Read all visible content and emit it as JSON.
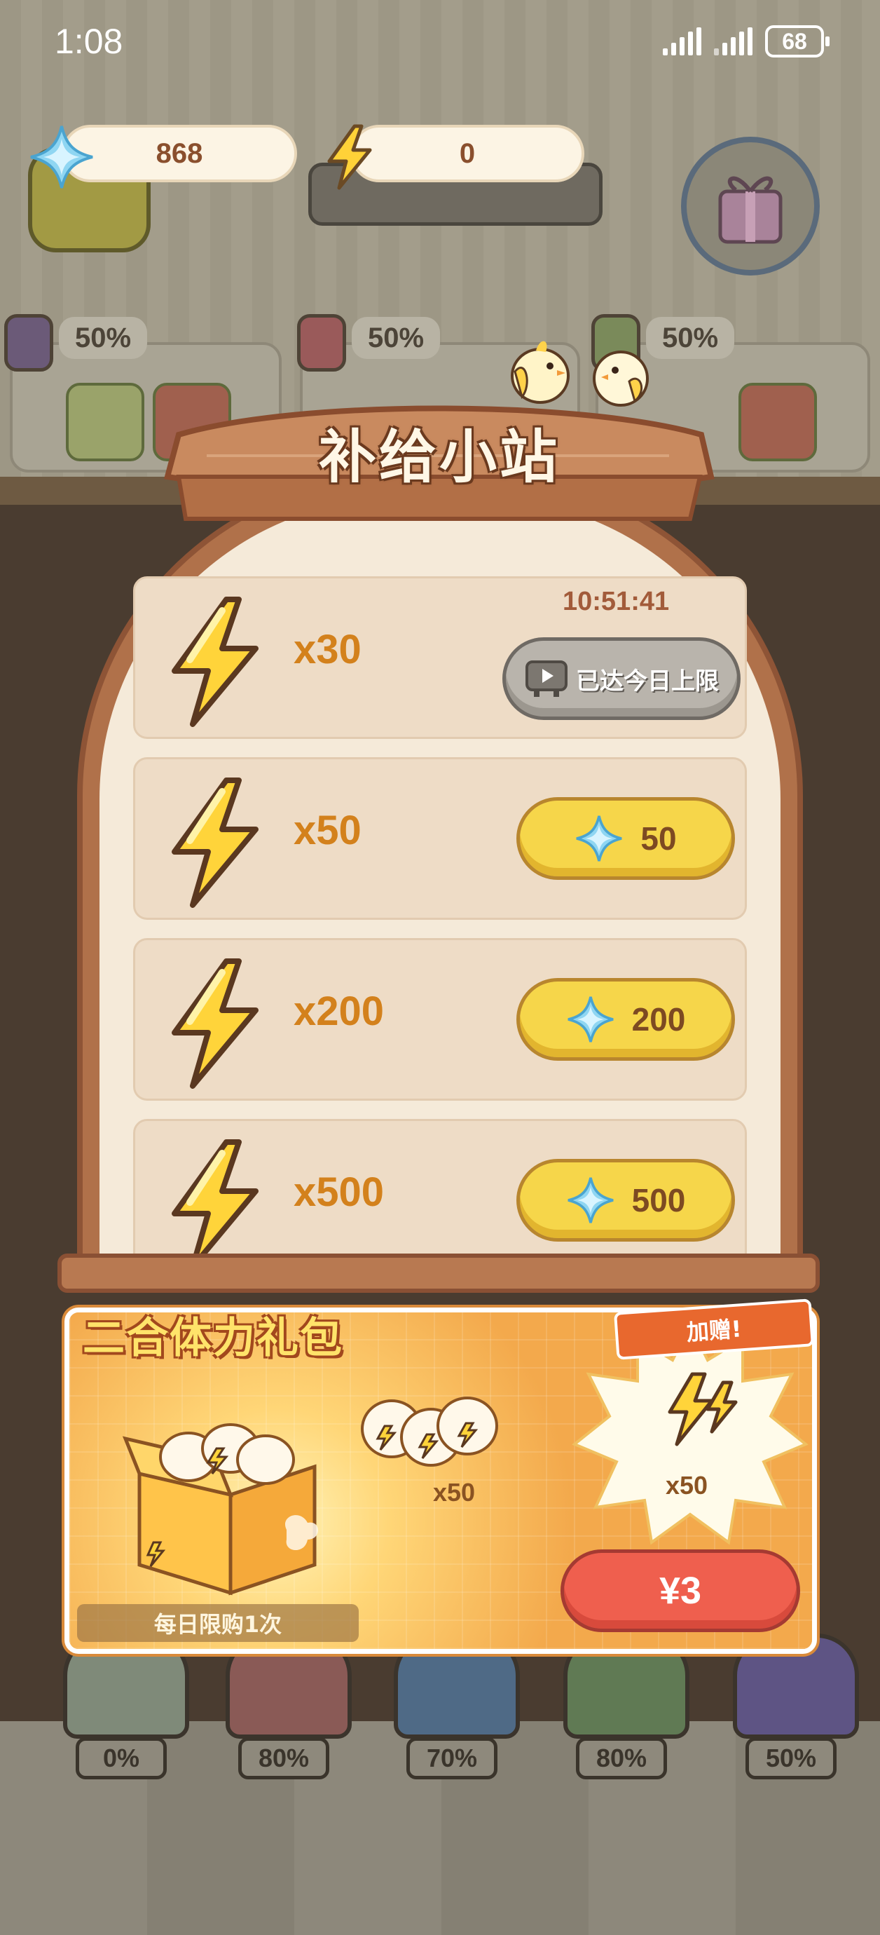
{
  "status_bar": {
    "time": "1:08",
    "battery": "68"
  },
  "currencies": {
    "gems": "868",
    "energy": "0"
  },
  "background": {
    "dish_percents": [
      "50%",
      "50%",
      "50%"
    ],
    "stove_percents": [
      "0%",
      "80%",
      "70%",
      "80%",
      "50%"
    ]
  },
  "panel": {
    "title": "补给小站",
    "offers": [
      {
        "amount": "x30",
        "timer": "10:51:41",
        "button_label": "已达今日上限",
        "button_icon": "video-play-icon",
        "state": "limit-reached"
      },
      {
        "amount": "x50",
        "price": "50",
        "currency_icon": "gem-icon"
      },
      {
        "amount": "x200",
        "price": "200",
        "currency_icon": "gem-icon"
      },
      {
        "amount": "x500",
        "price": "500",
        "currency_icon": "gem-icon"
      }
    ]
  },
  "bundle": {
    "title": "二合体力礼包",
    "daily_limit": "每日限购1次",
    "bags_quantity": "x50",
    "bonus_label": "加赠!",
    "bonus_quantity": "x50",
    "price": "¥3"
  },
  "colors": {
    "accent_orange": "#d3811c",
    "wood": "#b0714a",
    "button_yellow": "#f6d64a",
    "price_red": "#ef5f4e"
  }
}
